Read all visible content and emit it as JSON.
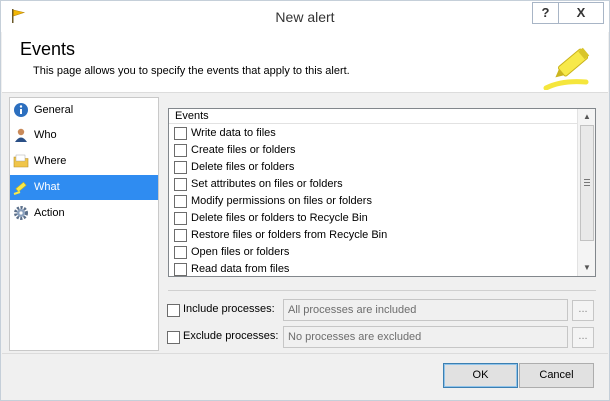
{
  "window": {
    "title": "New alert",
    "help_label": "?",
    "close_label": "X"
  },
  "header": {
    "title": "Events",
    "description": "This page allows you to specify the events that apply to this alert."
  },
  "nav": {
    "items": [
      {
        "label": "General",
        "icon": "info-icon",
        "active": false
      },
      {
        "label": "Who",
        "icon": "user-icon",
        "active": false
      },
      {
        "label": "Where",
        "icon": "folder-icon",
        "active": false
      },
      {
        "label": "What",
        "icon": "highlighter-icon",
        "active": true
      },
      {
        "label": "Action",
        "icon": "gear-icon",
        "active": false
      }
    ]
  },
  "events": {
    "header": "Events",
    "items": [
      {
        "label": "Write data to files",
        "checked": false
      },
      {
        "label": "Create files or folders",
        "checked": false
      },
      {
        "label": "Delete files or folders",
        "checked": false
      },
      {
        "label": "Set attributes on files or folders",
        "checked": false
      },
      {
        "label": "Modify permissions on files or folders",
        "checked": false
      },
      {
        "label": "Delete files or folders to Recycle Bin",
        "checked": false
      },
      {
        "label": "Restore files or folders from Recycle Bin",
        "checked": false
      },
      {
        "label": "Open files or folders",
        "checked": false
      },
      {
        "label": "Read data from files",
        "checked": false
      }
    ]
  },
  "processes": {
    "include": {
      "label": "Include processes:",
      "value": "All processes are included",
      "checked": false,
      "browse_label": "..."
    },
    "exclude": {
      "label": "Exclude processes:",
      "value": "No processes are excluded",
      "checked": false,
      "browse_label": "..."
    }
  },
  "buttons": {
    "ok_label": "OK",
    "cancel_label": "Cancel"
  },
  "colors": {
    "selection": "#2f8cf1",
    "accent_yellow": "#f5e63c"
  }
}
